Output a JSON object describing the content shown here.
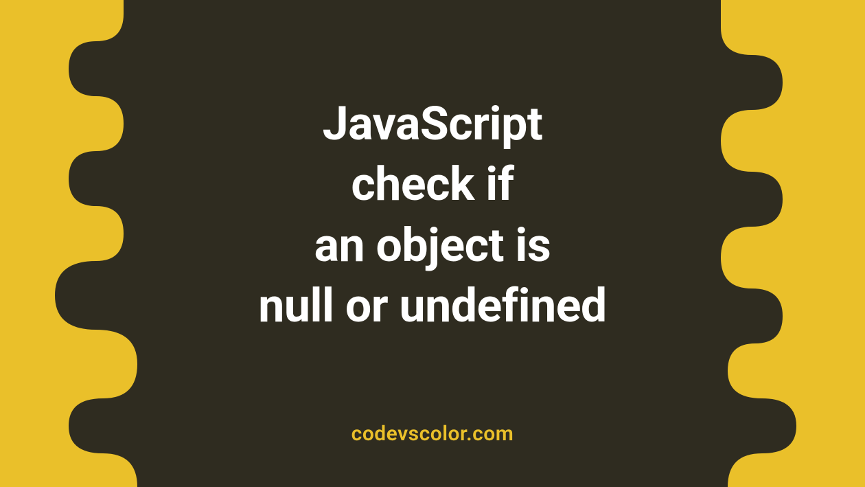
{
  "title_line1": "JavaScript",
  "title_line2": "check if",
  "title_line3": "an object is",
  "title_line4": "null or undefined",
  "watermark": "codevscolor.com",
  "colors": {
    "background": "#eac02a",
    "blob": "#2f2c20",
    "title_text": "#ffffff",
    "watermark_text": "#eac02a"
  }
}
